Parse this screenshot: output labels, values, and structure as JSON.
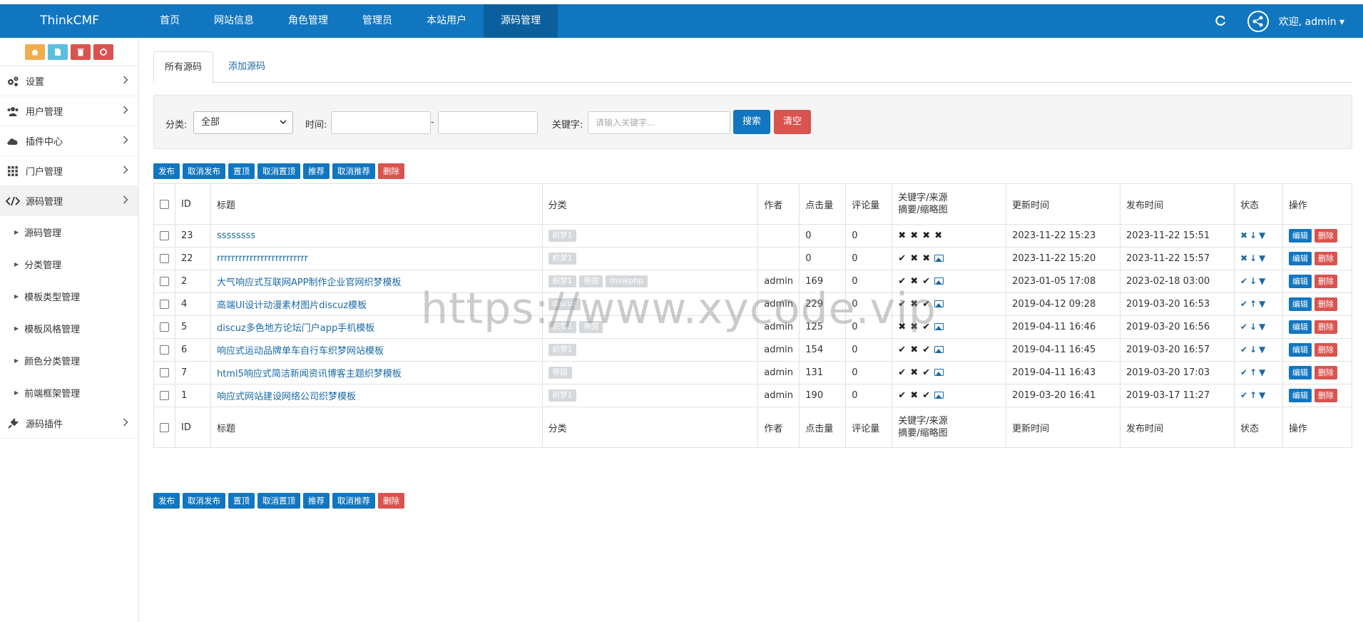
{
  "brand": "ThinkCMF",
  "nav": [
    "首页",
    "网站信息",
    "角色管理",
    "管理员",
    "本站用户",
    "源码管理"
  ],
  "nav_active": 5,
  "welcome": "欢迎, admin ▾",
  "sidebar": {
    "menu": [
      {
        "label": "设置",
        "icon": "gear-icon"
      },
      {
        "label": "用户管理",
        "icon": "users-icon"
      },
      {
        "label": "插件中心",
        "icon": "cloud-icon"
      },
      {
        "label": "门户管理",
        "icon": "grid-icon"
      },
      {
        "label": "源码管理",
        "icon": "code-icon"
      }
    ],
    "submenu": [
      "源码管理",
      "分类管理",
      "模板类型管理",
      "模板风格管理",
      "颜色分类管理",
      "前端框架管理"
    ],
    "plugin": {
      "label": "源码插件",
      "icon": "plug-icon"
    }
  },
  "tabs": [
    "所有源码",
    "添加源码"
  ],
  "filter": {
    "category_label": "分类:",
    "category_value": "全部",
    "time_label": "时间:",
    "time_sep": "-",
    "keyword_label": "关键字:",
    "keyword_placeholder": "请输入关键字...",
    "search_btn": "搜索",
    "clear_btn": "清空"
  },
  "bulk_actions": [
    "发布",
    "取消发布",
    "置顶",
    "取消置顶",
    "推荐",
    "取消推荐",
    "删除"
  ],
  "table": {
    "headers": {
      "id": "ID",
      "title": "标题",
      "category": "分类",
      "author": "作者",
      "hits": "点击量",
      "comments": "评论量",
      "kw1": "关键字/来源",
      "kw2": "摘要/缩略图",
      "updated": "更新时间",
      "published": "发布时间",
      "status": "状态",
      "ops": "操作"
    },
    "rows": [
      {
        "id": "23",
        "title": "ssssssss",
        "tags": [
          "织梦1"
        ],
        "author": "",
        "hits": "0",
        "comments": "0",
        "marks": [
          "x",
          "x",
          "x",
          "x"
        ],
        "updated": "2023-11-22 15:23",
        "published": "2023-11-22 15:51",
        "status": [
          "x",
          "down",
          "thumb-down"
        ]
      },
      {
        "id": "22",
        "title": "rrrrrrrrrrrrrrrrrrrrrrrrr",
        "tags": [
          "织梦1"
        ],
        "author": "",
        "hits": "0",
        "comments": "0",
        "marks": [
          "check",
          "x",
          "x",
          "pic"
        ],
        "updated": "2023-11-22 15:20",
        "published": "2023-11-22 15:57",
        "status": [
          "x",
          "down",
          "thumb-down"
        ]
      },
      {
        "id": "2",
        "title": "大气响应式互联网APP制作企业官网织梦模板",
        "tags": [
          "织梦1",
          "帝国",
          "thinkphp"
        ],
        "author": "admin",
        "hits": "169",
        "comments": "0",
        "marks": [
          "check",
          "x",
          "check",
          "pic"
        ],
        "updated": "2023-01-05 17:08",
        "published": "2023-02-18 03:00",
        "status": [
          "check",
          "down",
          "thumb-down"
        ]
      },
      {
        "id": "4",
        "title": "高端UI设计动漫素材图片discuz模板",
        "tags": [
          "discuz"
        ],
        "author": "admin",
        "hits": "229",
        "comments": "0",
        "marks": [
          "check",
          "x",
          "check",
          "pic"
        ],
        "updated": "2019-04-12 09:28",
        "published": "2019-03-20 16:53",
        "status": [
          "check",
          "up",
          "thumb-down"
        ]
      },
      {
        "id": "5",
        "title": "discuz多色地方论坛门户app手机模板",
        "tags": [
          "织梦1",
          "帝国"
        ],
        "author": "admin",
        "hits": "125",
        "comments": "0",
        "marks": [
          "x",
          "x",
          "check",
          "pic"
        ],
        "updated": "2019-04-11 16:46",
        "published": "2019-03-20 16:56",
        "status": [
          "check",
          "down",
          "thumb-down"
        ]
      },
      {
        "id": "6",
        "title": "响应式运动品牌单车自行车织梦网站模板",
        "tags": [
          "织梦1"
        ],
        "author": "admin",
        "hits": "154",
        "comments": "0",
        "marks": [
          "check",
          "x",
          "check",
          "pic"
        ],
        "updated": "2019-04-11 16:45",
        "published": "2019-03-20 16:57",
        "status": [
          "check",
          "down",
          "thumb-down"
        ]
      },
      {
        "id": "7",
        "title": "html5响应式简洁新闻资讯博客主题织梦模板",
        "tags": [
          "帝国"
        ],
        "author": "admin",
        "hits": "131",
        "comments": "0",
        "marks": [
          "check",
          "x",
          "check",
          "pic"
        ],
        "updated": "2019-04-11 16:43",
        "published": "2019-03-20 17:03",
        "status": [
          "check",
          "up",
          "thumb-down"
        ]
      },
      {
        "id": "1",
        "title": "响应式网站建设网络公司织梦模板",
        "tags": [
          "织梦1"
        ],
        "author": "admin",
        "hits": "190",
        "comments": "0",
        "marks": [
          "check",
          "x",
          "check",
          "pic"
        ],
        "updated": "2019-03-20 16:41",
        "published": "2019-03-17 11:27",
        "status": [
          "check",
          "up",
          "thumb-down"
        ]
      }
    ],
    "edit_label": "编辑",
    "delete_label": "删除"
  },
  "watermark": "https://www.xycode.vip",
  "colors": {
    "primary": "#1176c0",
    "danger": "#d9534f",
    "tag": "#d6d9dc"
  }
}
